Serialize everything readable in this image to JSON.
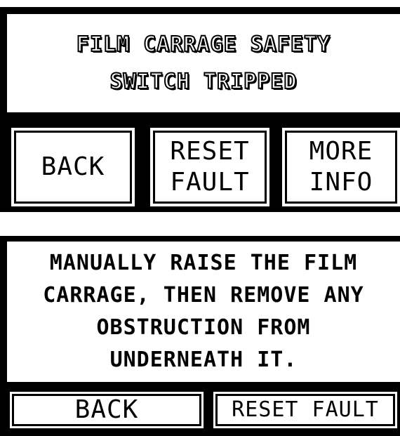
{
  "screen1": {
    "message_lines": [
      "FILM CARRAGE SAFETY",
      "SWITCH TRIPPED"
    ],
    "buttons": {
      "back": "BACK",
      "reset": [
        "RESET",
        "FAULT"
      ],
      "more_info": [
        "MORE",
        "INFO"
      ]
    }
  },
  "screen2": {
    "message_lines": [
      "MANUALLY RAISE THE FILM",
      "CARRAGE, THEN REMOVE ANY",
      "OBSTRUCTION FROM",
      "UNDERNEATH IT."
    ],
    "buttons": {
      "back": "BACK",
      "reset": "RESET FAULT"
    }
  },
  "colors": {
    "background": "#000000",
    "panel": "#ffffff",
    "text": "#000000"
  }
}
